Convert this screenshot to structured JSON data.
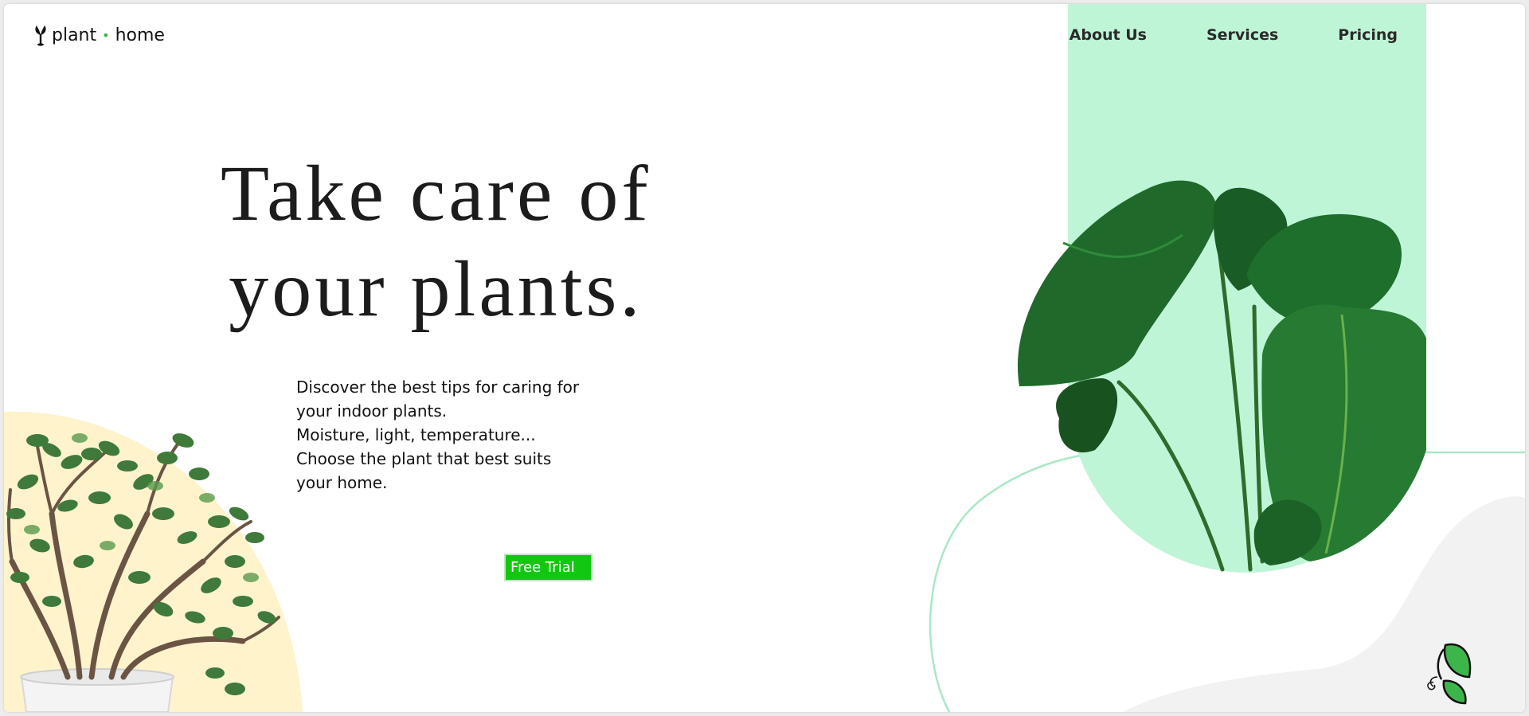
{
  "brand": {
    "name_left": "plant",
    "separator": "•",
    "name_right": "home"
  },
  "nav": {
    "items": [
      "About Us",
      "Services",
      "Pricing"
    ]
  },
  "hero": {
    "title_line1": "Take care of",
    "title_line2": "your plants.",
    "description": [
      "Discover the best tips for caring for",
      "your indoor plants.",
      "Moisture, light, temperature...",
      "Choose the plant that best suits",
      "your home."
    ],
    "cta_label": "Free Trial"
  },
  "icons": {
    "logo": "plant-pin-icon",
    "corner": "leaf-bugs-icon",
    "left_plant": "jade-plant-image",
    "right_plant": "monstera-plant-image"
  },
  "colors": {
    "accent_green": "#11c712",
    "panel_mint": "#bff5d7",
    "arc_cream": "#fff3cc",
    "line_mint": "#a9e8c6",
    "wave_gray": "#f2f2f2",
    "dot_green": "#3cb54a"
  }
}
